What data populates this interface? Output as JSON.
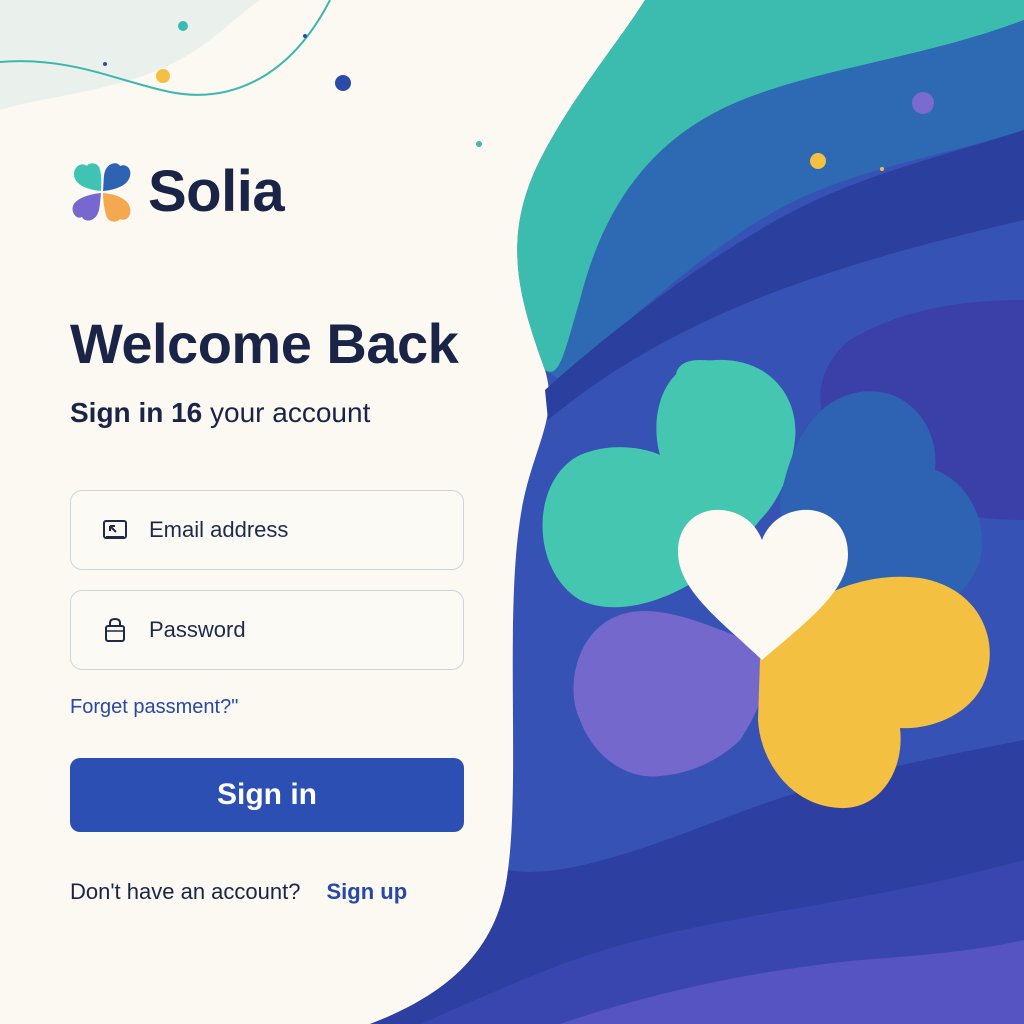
{
  "brand": {
    "name": "Solia",
    "logo_icon": "clover-heart-icon"
  },
  "login": {
    "title": "Welcome Back",
    "subtitle_strong": "Sign in 16",
    "subtitle_rest": " your account",
    "email": {
      "placeholder": "Email address",
      "icon": "image-envelope-icon"
    },
    "password": {
      "placeholder": "Password",
      "icon": "lock-icon"
    },
    "forgot_label": "Forget passment?\"",
    "submit_label": "Sign in",
    "signup_prompt": "Don't have an account?",
    "signup_label": "Sign up"
  },
  "colors": {
    "background": "#fbf9f2",
    "text": "#1a2447",
    "primary": "#2b4fb3",
    "link": "#2748a8",
    "teal": "#3fc4b4",
    "blue": "#2a59b0",
    "purple": "#7768cf",
    "yellow": "#f4c042"
  }
}
